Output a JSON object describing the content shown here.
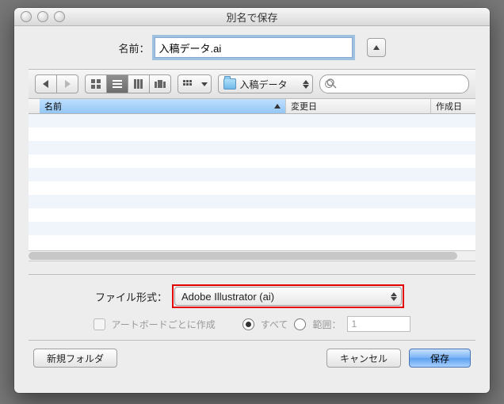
{
  "window": {
    "title": "別名で保存"
  },
  "name_row": {
    "label": "名前：",
    "value": "入稿データ.ai"
  },
  "toolbar": {
    "location_label": "入稿データ",
    "search_placeholder": ""
  },
  "columns": {
    "name": "名前",
    "modified": "変更日",
    "created": "作成日"
  },
  "format": {
    "label": "ファイル形式：",
    "value": "Adobe Illustrator (ai)"
  },
  "artboard": {
    "checkbox_label": "アートボードごとに作成",
    "radio_all": "すべて",
    "radio_range": "範囲：",
    "range_value": "1"
  },
  "buttons": {
    "new_folder": "新規フォルダ",
    "cancel": "キャンセル",
    "save": "保存"
  }
}
